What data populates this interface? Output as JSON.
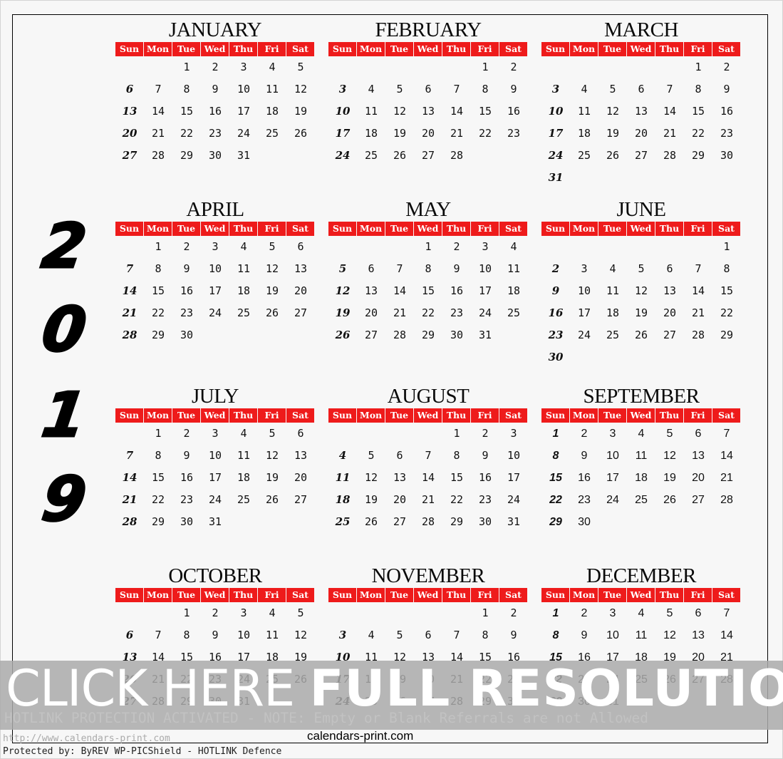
{
  "year_digits": [
    "2",
    "0",
    "1",
    "9"
  ],
  "weekday_labels": [
    "Sun",
    "Mon",
    "Tue",
    "Wed",
    "Thu",
    "Fri",
    "Sat"
  ],
  "colors": {
    "header_bg": "#ee1b1b",
    "header_text": "#ffffff",
    "overlay": "#aaaaaa"
  },
  "months": [
    {
      "name": "JANUARY",
      "weeks": [
        [
          "",
          "",
          "1",
          "2",
          "3",
          "4",
          "5"
        ],
        [
          "6",
          "7",
          "8",
          "9",
          "10",
          "11",
          "12"
        ],
        [
          "13",
          "14",
          "15",
          "16",
          "17",
          "18",
          "19"
        ],
        [
          "20",
          "21",
          "22",
          "23",
          "24",
          "25",
          "26"
        ],
        [
          "27",
          "28",
          "29",
          "30",
          "31",
          "",
          ""
        ]
      ]
    },
    {
      "name": "FEBRUARY",
      "weeks": [
        [
          "",
          "",
          "",
          "",
          "",
          "1",
          "2"
        ],
        [
          "3",
          "4",
          "5",
          "6",
          "7",
          "8",
          "9"
        ],
        [
          "10",
          "11",
          "12",
          "13",
          "14",
          "15",
          "16"
        ],
        [
          "17",
          "18",
          "19",
          "20",
          "21",
          "22",
          "23"
        ],
        [
          "24",
          "25",
          "26",
          "27",
          "28",
          "",
          ""
        ]
      ]
    },
    {
      "name": "MARCH",
      "weeks": [
        [
          "",
          "",
          "",
          "",
          "",
          "1",
          "2"
        ],
        [
          "3",
          "4",
          "5",
          "6",
          "7",
          "8",
          "9"
        ],
        [
          "10",
          "11",
          "12",
          "13",
          "14",
          "15",
          "16"
        ],
        [
          "17",
          "18",
          "19",
          "20",
          "21",
          "22",
          "23"
        ],
        [
          "24",
          "25",
          "26",
          "27",
          "28",
          "29",
          "30"
        ],
        [
          "31",
          "",
          "",
          "",
          "",
          "",
          ""
        ]
      ]
    },
    {
      "name": "APRIL",
      "weeks": [
        [
          "",
          "1",
          "2",
          "3",
          "4",
          "5",
          "6"
        ],
        [
          "7",
          "8",
          "9",
          "10",
          "11",
          "12",
          "13"
        ],
        [
          "14",
          "15",
          "16",
          "17",
          "18",
          "19",
          "20"
        ],
        [
          "21",
          "22",
          "23",
          "24",
          "25",
          "26",
          "27"
        ],
        [
          "28",
          "29",
          "30",
          "",
          "",
          "",
          ""
        ]
      ]
    },
    {
      "name": "MAY",
      "weeks": [
        [
          "",
          "",
          "",
          "1",
          "2",
          "3",
          "4"
        ],
        [
          "5",
          "6",
          "7",
          "8",
          "9",
          "10",
          "11"
        ],
        [
          "12",
          "13",
          "14",
          "15",
          "16",
          "17",
          "18"
        ],
        [
          "19",
          "20",
          "21",
          "22",
          "23",
          "24",
          "25"
        ],
        [
          "26",
          "27",
          "28",
          "29",
          "30",
          "31",
          ""
        ]
      ]
    },
    {
      "name": "JUNE",
      "weeks": [
        [
          "",
          "",
          "",
          "",
          "",
          "",
          "1"
        ],
        [
          "2",
          "3",
          "4",
          "5",
          "6",
          "7",
          "8"
        ],
        [
          "9",
          "10",
          "11",
          "12",
          "13",
          "14",
          "15"
        ],
        [
          "16",
          "17",
          "18",
          "19",
          "20",
          "21",
          "22"
        ],
        [
          "23",
          "24",
          "25",
          "26",
          "27",
          "28",
          "29"
        ],
        [
          "30",
          "",
          "",
          "",
          "",
          "",
          ""
        ]
      ]
    },
    {
      "name": "JULY",
      "weeks": [
        [
          "",
          "1",
          "2",
          "3",
          "4",
          "5",
          "6"
        ],
        [
          "7",
          "8",
          "9",
          "10",
          "11",
          "12",
          "13"
        ],
        [
          "14",
          "15",
          "16",
          "17",
          "18",
          "19",
          "20"
        ],
        [
          "21",
          "22",
          "23",
          "24",
          "25",
          "26",
          "27"
        ],
        [
          "28",
          "29",
          "30",
          "31",
          "",
          "",
          ""
        ]
      ]
    },
    {
      "name": "AUGUST",
      "weeks": [
        [
          "",
          "",
          "",
          "",
          "1",
          "2",
          "3"
        ],
        [
          "4",
          "5",
          "6",
          "7",
          "8",
          "9",
          "10"
        ],
        [
          "11",
          "12",
          "13",
          "14",
          "15",
          "16",
          "17"
        ],
        [
          "18",
          "19",
          "20",
          "21",
          "22",
          "23",
          "24"
        ],
        [
          "25",
          "26",
          "27",
          "28",
          "29",
          "30",
          "31"
        ]
      ]
    },
    {
      "name": "SEPTEMBER",
      "weeks": [
        [
          "1",
          "2",
          "3",
          "4",
          "5",
          "6",
          "7"
        ],
        [
          "8",
          "9",
          "10",
          "11",
          "12",
          "13",
          "14"
        ],
        [
          "15",
          "16",
          "17",
          "18",
          "19",
          "20",
          "21"
        ],
        [
          "22",
          "23",
          "24",
          "25",
          "26",
          "27",
          "28"
        ],
        [
          "29",
          "30",
          "",
          "",
          "",
          "",
          ""
        ]
      ]
    },
    {
      "name": "OCTOBER",
      "weeks": [
        [
          "",
          "",
          "1",
          "2",
          "3",
          "4",
          "5"
        ],
        [
          "6",
          "7",
          "8",
          "9",
          "10",
          "11",
          "12"
        ],
        [
          "13",
          "14",
          "15",
          "16",
          "17",
          "18",
          "19"
        ],
        [
          "20",
          "21",
          "22",
          "23",
          "24",
          "25",
          "26"
        ],
        [
          "27",
          "28",
          "29",
          "30",
          "31",
          "",
          ""
        ]
      ]
    },
    {
      "name": "NOVEMBER",
      "weeks": [
        [
          "",
          "",
          "",
          "",
          "",
          "1",
          "2"
        ],
        [
          "3",
          "4",
          "5",
          "6",
          "7",
          "8",
          "9"
        ],
        [
          "10",
          "11",
          "12",
          "13",
          "14",
          "15",
          "16"
        ],
        [
          "17",
          "18",
          "19",
          "20",
          "21",
          "22",
          "23"
        ],
        [
          "24",
          "25",
          "26",
          "27",
          "28",
          "29",
          "30"
        ]
      ]
    },
    {
      "name": "DECEMBER",
      "weeks": [
        [
          "1",
          "2",
          "3",
          "4",
          "5",
          "6",
          "7"
        ],
        [
          "8",
          "9",
          "10",
          "11",
          "12",
          "13",
          "14"
        ],
        [
          "15",
          "16",
          "17",
          "18",
          "19",
          "20",
          "21"
        ],
        [
          "22",
          "23",
          "24",
          "25",
          "26",
          "27",
          "28"
        ],
        [
          "29",
          "30",
          "31",
          "",
          "",
          "",
          ""
        ]
      ]
    }
  ],
  "overlay": {
    "click_here": "CLICK HERE ",
    "full_resolution": "FULL RESOLUTION",
    "notice": "HOTLINK PROTECTION ACTIVATED - NOTE: Empty or Blank Referrals are not Allowed"
  },
  "footer": {
    "url": "http://www.calendars-print.com",
    "site_name": "calendars-print.com",
    "protected_by": "Protected by: ByREV WP-PICShield - HOTLINK Defence"
  }
}
